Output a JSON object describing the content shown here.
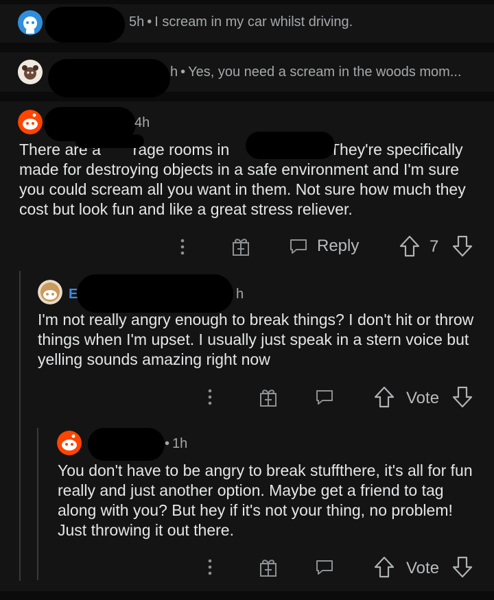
{
  "collapsed_comments": [
    {
      "age": "5h",
      "snippet": "I scream in my car whilst driving."
    },
    {
      "age": "h",
      "snippet": "Yes, you need a scream in the woods mom..."
    }
  ],
  "comments": [
    {
      "age": "4h",
      "body_line1_a": "There are a ",
      "body_line1_b": " rage rooms in",
      "body_line1_c": "They're specifically",
      "body_rest": "made for destroying objects in a safe environment and I'm sure you could scream all you want in them.  Not sure how much they cost but look fun and like a great stress reliever.",
      "reply_label": "Reply",
      "score": "7"
    },
    {
      "author_initial": "E",
      "age": "h",
      "body": "I'm not really angry enough to break things?   I don't hit or throw things when I'm upset.   I usually just speak in a stern voice but yelling sounds amazing right now",
      "vote_label": "Vote"
    },
    {
      "age": "1h",
      "body": "You don't have to be angry to break stuffthere, it's all for fun really and just another option.  Maybe get a friend to tag along with you?  But hey if it's not your thing, no problem! Just throwing it out there.",
      "vote_label": "Vote"
    }
  ],
  "dot_separator": "•",
  "colors": {
    "background": "#0b0b0b",
    "card": "#141414",
    "text": "#e4e6e8",
    "meta": "#a5a8ab",
    "reddit_orange": "#ff4500"
  }
}
